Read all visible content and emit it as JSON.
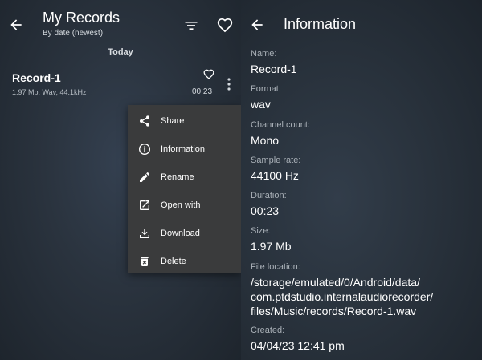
{
  "left_pane": {
    "header": {
      "title": "My Records",
      "subtitle": "By date (newest)"
    },
    "section_label": "Today",
    "record": {
      "name": "Record-1",
      "meta": "1.97 Mb, Wav, 44.1kHz",
      "duration": "00:23"
    },
    "context_menu": {
      "items": [
        {
          "label": "Share",
          "icon": "share-icon"
        },
        {
          "label": "Information",
          "icon": "info-icon"
        },
        {
          "label": "Rename",
          "icon": "pencil-icon"
        },
        {
          "label": "Open with",
          "icon": "open-external-icon"
        },
        {
          "label": "Download",
          "icon": "download-icon"
        },
        {
          "label": "Delete",
          "icon": "trash-icon"
        }
      ]
    }
  },
  "right_pane": {
    "header": {
      "title": "Information"
    },
    "fields": [
      {
        "label": "Name:",
        "value": "Record-1"
      },
      {
        "label": "Format:",
        "value": "wav"
      },
      {
        "label": "Channel count:",
        "value": "Mono"
      },
      {
        "label": "Sample rate:",
        "value": "44100 Hz"
      },
      {
        "label": "Duration:",
        "value": "00:23"
      },
      {
        "label": "Size:",
        "value": "1.97 Mb"
      },
      {
        "label": "File location:",
        "value_lines": [
          "/storage/emulated/0/Android/data/",
          "com.ptdstudio.internalaudiorecorder/",
          "files/Music/records/Record-1.wav"
        ]
      },
      {
        "label": "Created:",
        "value": "04/04/23 12:41 pm"
      }
    ]
  },
  "colors": {
    "background": "#232a33",
    "menu_background": "#3a3b3c",
    "label_gray": "#aab1b8",
    "text_white": "#ffffff"
  }
}
